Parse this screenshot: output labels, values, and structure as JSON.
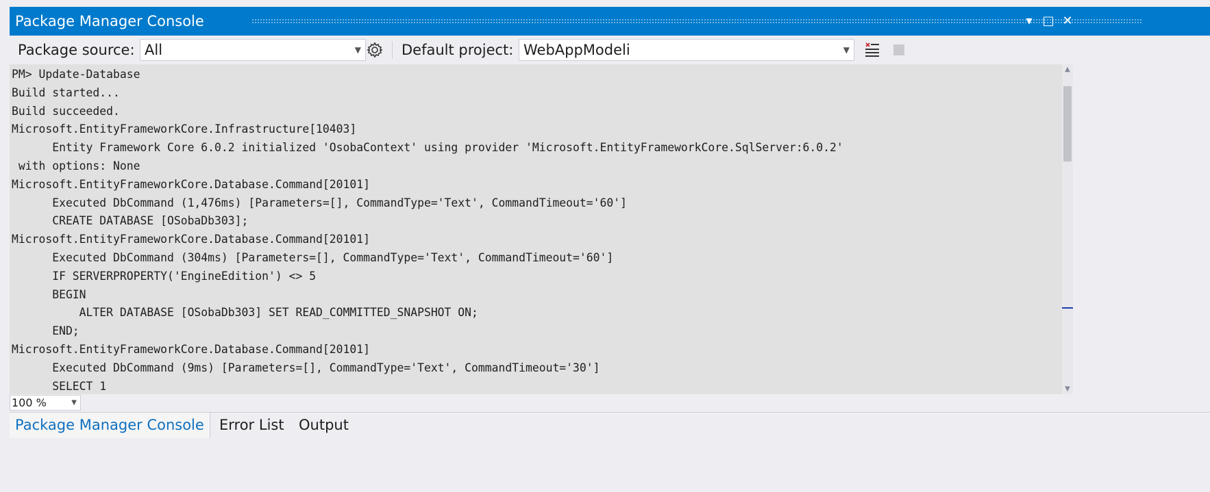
{
  "window": {
    "title": "Package Manager Console",
    "dropdown_glyph": "▾",
    "maximize_glyph": "□",
    "close_glyph": "✕"
  },
  "toolbar": {
    "package_source_label": "Package source:",
    "package_source_value": "All",
    "default_project_label": "Default project:",
    "default_project_value": "WebAppModeli",
    "icons": [
      "dropdown-arrow-icon",
      "settings-gear-icon",
      "clear-console-icon",
      "stop-icon"
    ]
  },
  "console": {
    "lines": [
      "PM> Update-Database",
      "Build started...",
      "Build succeeded.",
      "Microsoft.EntityFrameworkCore.Infrastructure[10403]",
      "      Entity Framework Core 6.0.2 initialized 'OsobaContext' using provider 'Microsoft.EntityFrameworkCore.SqlServer:6.0.2'",
      " with options: None",
      "Microsoft.EntityFrameworkCore.Database.Command[20101]",
      "      Executed DbCommand (1,476ms) [Parameters=[], CommandType='Text', CommandTimeout='60']",
      "      CREATE DATABASE [OSobaDb303];",
      "Microsoft.EntityFrameworkCore.Database.Command[20101]",
      "      Executed DbCommand (304ms) [Parameters=[], CommandType='Text', CommandTimeout='60']",
      "      IF SERVERPROPERTY('EngineEdition') <> 5",
      "      BEGIN",
      "          ALTER DATABASE [OSobaDb303] SET READ_COMMITTED_SNAPSHOT ON;",
      "      END;",
      "Microsoft.EntityFrameworkCore.Database.Command[20101]",
      "      Executed DbCommand (9ms) [Parameters=[], CommandType='Text', CommandTimeout='30']",
      "      SELECT 1"
    ]
  },
  "zoom": {
    "value": "100 %"
  },
  "tabs": [
    {
      "label": "Package Manager Console",
      "active": true
    },
    {
      "label": "Error List",
      "active": false
    },
    {
      "label": "Output",
      "active": false
    }
  ],
  "colors": {
    "accent": "#007acc",
    "console_bg": "#e1e1e1",
    "active_tab_text": "#0e70c0"
  }
}
